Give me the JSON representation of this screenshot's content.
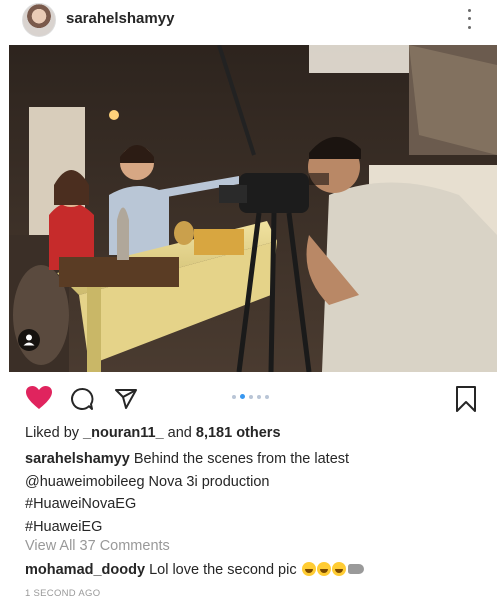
{
  "post": {
    "username": "sarahelshamyy",
    "likes": {
      "prefix": "Liked by ",
      "liker": "_nouran11_",
      "middle": " and ",
      "count": "8,181 others"
    },
    "caption": {
      "author": "sarahelshamyy",
      "line1": " Behind the scenes from the latest",
      "line2": "@huaweimobileeg Nova 3i production",
      "line3": "#HuaweiNovaEG",
      "line4": "#HuaweiEG"
    },
    "view_all": "View All 37 Comments",
    "comment": {
      "author": "mohamad_doody",
      "text": " Lol love the second pic"
    },
    "timestamp": "1 SECOND AGO",
    "carousel": {
      "count": 5,
      "active": 1
    }
  },
  "colors": {
    "heart": "#e0245e",
    "link": "#262626",
    "muted": "#999999",
    "active_dot": "#3897f0"
  },
  "icons": [
    "more-icon",
    "profile-tag-icon",
    "heart-icon",
    "comment-icon",
    "share-icon",
    "save-icon"
  ]
}
